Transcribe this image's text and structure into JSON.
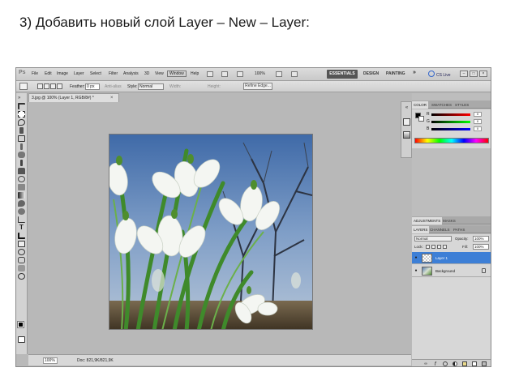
{
  "slide": {
    "title": "3) Добавить новый слой Layer – New – Layer:"
  },
  "menubar": {
    "logo": "Ps",
    "items": [
      "File",
      "Edit",
      "Image",
      "Layer",
      "Select",
      "Filter",
      "Analysis",
      "3D",
      "View",
      "Window",
      "Help"
    ],
    "zoom": "100%",
    "workspaces": [
      "ESSENTIALS",
      "DESIGN",
      "PAINTING"
    ],
    "more": "»",
    "cs_live": "CS Live",
    "window_controls": [
      "–",
      "□",
      "×"
    ]
  },
  "options": {
    "feather_label": "Feather:",
    "feather_value": "0 px",
    "anti_alias": "Anti-alias",
    "style_label": "Style:",
    "style_value": "Normal",
    "width_label": "Width:",
    "height_label": "Height:",
    "refine": "Refine Edge..."
  },
  "document": {
    "tab": "3.jpg @ 100% (Layer 1, RGB/8#) *",
    "close": "×",
    "zoom": "100%",
    "doc_info": "Doc: 821,9K/821,9K"
  },
  "color_panel": {
    "tabs": [
      "COLOR",
      "SWATCHES",
      "STYLES"
    ],
    "channels": [
      "R",
      "G",
      "B"
    ],
    "values": [
      "0",
      "0",
      "0"
    ]
  },
  "adjustments_panel": {
    "tabs": [
      "ADJUSTMENTS",
      "MASKS"
    ]
  },
  "layers_panel": {
    "tabs": [
      "LAYERS",
      "CHANNELS",
      "PATHS"
    ],
    "blend_mode": "Normal",
    "opacity_label": "Opacity:",
    "opacity_value": "100%",
    "lock_label": "Lock:",
    "fill_label": "Fill:",
    "fill_value": "100%",
    "layers": [
      {
        "name": "Layer 1",
        "selected": true
      },
      {
        "name": "Background",
        "selected": false
      }
    ],
    "footer_icons": [
      "link-icon",
      "fx-icon",
      "mask-icon",
      "adjustment-icon",
      "folder-icon",
      "new-layer-icon",
      "trash-icon"
    ]
  },
  "colors": {
    "accent": "#3d7fd6",
    "ui_gray": "#b9b9b9"
  }
}
